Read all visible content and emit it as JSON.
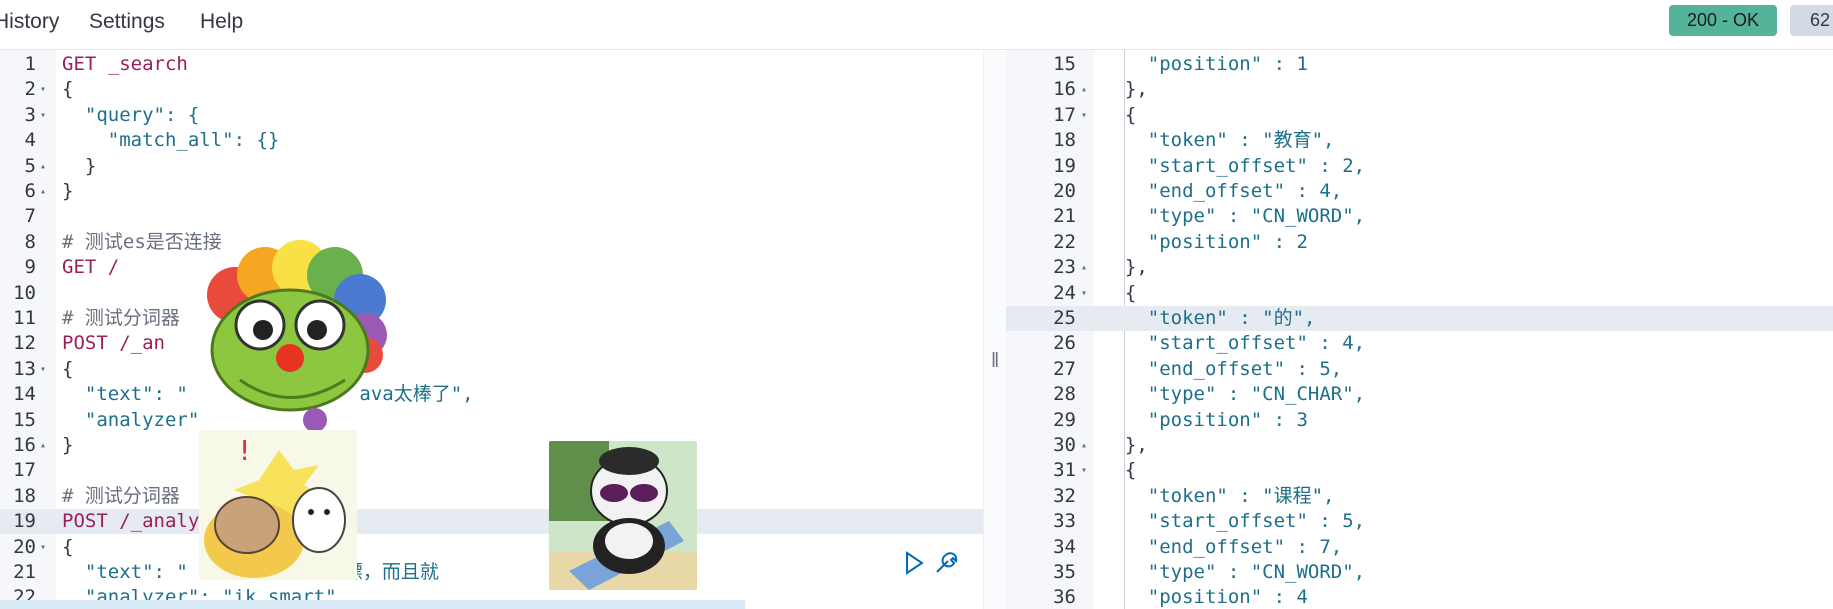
{
  "menu": {
    "history": "History",
    "settings": "Settings",
    "help": "Help"
  },
  "status": {
    "code": "200 - OK",
    "time": "62"
  },
  "colors": {
    "status_ok": "#54b399",
    "keyword": "#9b1f5b",
    "string": "#1e6f8a"
  },
  "request": {
    "lines": [
      {
        "n": "1",
        "fold": "",
        "text": "GET _search",
        "cls": "kw"
      },
      {
        "n": "2",
        "fold": "▾",
        "text": "{",
        "cls": "pl"
      },
      {
        "n": "3",
        "fold": "▾",
        "text": "  \"query\": {",
        "cls": "str"
      },
      {
        "n": "4",
        "fold": "",
        "text": "    \"match_all\": {}",
        "cls": "str"
      },
      {
        "n": "5",
        "fold": "▴",
        "text": "  }",
        "cls": "pl"
      },
      {
        "n": "6",
        "fold": "▴",
        "text": "}",
        "cls": "pl"
      },
      {
        "n": "7",
        "fold": "",
        "text": "",
        "cls": "pl"
      },
      {
        "n": "8",
        "fold": "",
        "text": "# 测试es是否连接",
        "cls": "cm"
      },
      {
        "n": "9",
        "fold": "",
        "text": "GET /",
        "cls": "kw"
      },
      {
        "n": "10",
        "fold": "",
        "text": "",
        "cls": "pl"
      },
      {
        "n": "11",
        "fold": "",
        "text": "# 测试分词器",
        "cls": "cm"
      },
      {
        "n": "12",
        "fold": "",
        "text": "POST /_an",
        "cls": "kw"
      },
      {
        "n": "13",
        "fold": "▾",
        "text": "{",
        "cls": "pl"
      },
      {
        "n": "14",
        "fold": "",
        "text": "  \"text\": \"               ava太棒了\",",
        "cls": "str"
      },
      {
        "n": "15",
        "fold": "",
        "text": "  \"analyzer\"",
        "cls": "str"
      },
      {
        "n": "16",
        "fold": "▴",
        "text": "}",
        "cls": "pl"
      },
      {
        "n": "17",
        "fold": "",
        "text": "",
        "cls": "pl"
      },
      {
        "n": "18",
        "fold": "",
        "text": "# 测试分词器",
        "cls": "cm"
      },
      {
        "n": "19",
        "fold": "",
        "text": "POST /_analy",
        "cls": "kw"
      },
      {
        "n": "20",
        "fold": "▾",
        "text": "{",
        "cls": "pl"
      },
      {
        "n": "21",
        "fold": "",
        "text": "  \"text\": \"       提可以白嫖，而且就          奥力给！\",",
        "cls": "str"
      },
      {
        "n": "22",
        "fold": "",
        "text": "  \"analyzer\": \"ik_smart\"",
        "cls": "str"
      }
    ]
  },
  "response": {
    "lines": [
      {
        "n": "15",
        "fold": "",
        "text": "    \"position\" : 1",
        "cls": "str"
      },
      {
        "n": "16",
        "fold": "▴",
        "text": "  },",
        "cls": "pl"
      },
      {
        "n": "17",
        "fold": "▾",
        "text": "  {",
        "cls": "pl"
      },
      {
        "n": "18",
        "fold": "",
        "text": "    \"token\" : \"教育\",",
        "cls": "str"
      },
      {
        "n": "19",
        "fold": "",
        "text": "    \"start_offset\" : 2,",
        "cls": "str"
      },
      {
        "n": "20",
        "fold": "",
        "text": "    \"end_offset\" : 4,",
        "cls": "str"
      },
      {
        "n": "21",
        "fold": "",
        "text": "    \"type\" : \"CN_WORD\",",
        "cls": "str"
      },
      {
        "n": "22",
        "fold": "",
        "text": "    \"position\" : 2",
        "cls": "str"
      },
      {
        "n": "23",
        "fold": "▴",
        "text": "  },",
        "cls": "pl"
      },
      {
        "n": "24",
        "fold": "▾",
        "text": "  {",
        "cls": "pl"
      },
      {
        "n": "25",
        "fold": "",
        "text": "    \"token\" : \"的\",",
        "cls": "str"
      },
      {
        "n": "26",
        "fold": "",
        "text": "    \"start_offset\" : 4,",
        "cls": "str"
      },
      {
        "n": "27",
        "fold": "",
        "text": "    \"end_offset\" : 5,",
        "cls": "str"
      },
      {
        "n": "28",
        "fold": "",
        "text": "    \"type\" : \"CN_CHAR\",",
        "cls": "str"
      },
      {
        "n": "29",
        "fold": "",
        "text": "    \"position\" : 3",
        "cls": "str"
      },
      {
        "n": "30",
        "fold": "▴",
        "text": "  },",
        "cls": "pl"
      },
      {
        "n": "31",
        "fold": "▾",
        "text": "  {",
        "cls": "pl"
      },
      {
        "n": "32",
        "fold": "",
        "text": "    \"token\" : \"课程\",",
        "cls": "str"
      },
      {
        "n": "33",
        "fold": "",
        "text": "    \"start_offset\" : 5,",
        "cls": "str"
      },
      {
        "n": "34",
        "fold": "",
        "text": "    \"end_offset\" : 7,",
        "cls": "str"
      },
      {
        "n": "35",
        "fold": "",
        "text": "    \"type\" : \"CN_WORD\",",
        "cls": "str"
      },
      {
        "n": "36",
        "fold": "",
        "text": "    \"position\" : 4",
        "cls": "str"
      }
    ]
  },
  "icons": {
    "run": "play-icon",
    "settings": "wrench-icon",
    "splitter": "resize-handle-icon"
  }
}
